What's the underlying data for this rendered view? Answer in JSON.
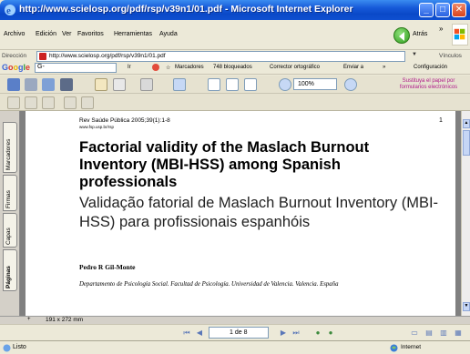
{
  "window": {
    "title": "http://www.scielosp.org/pdf/rsp/v39n1/01.pdf - Microsoft Internet Explorer",
    "min_glyph": "_",
    "max_glyph": "□",
    "close_glyph": "✕"
  },
  "menu": {
    "items": [
      "Archivo",
      "Edición",
      "Ver",
      "Favoritos",
      "Herramientas",
      "Ayuda"
    ],
    "back_label": "Atrás",
    "chevron": "»"
  },
  "address": {
    "label": "Dirección",
    "value": "http://www.scielosp.org/pdf/rsp/v39n1/01.pdf",
    "links_label": "Vínculos"
  },
  "google_bar": {
    "logo": "Google",
    "search_value": "G-",
    "go_label": "Ir",
    "bookmarks_label": "Marcadores",
    "blocked_label": "748 bloqueados",
    "spellcheck_label": "Corrector ortográfico",
    "send_label": "Enviar a",
    "settings_label": "Configuración"
  },
  "acrobat": {
    "zoom_value": "100%",
    "promo_text": "Sustituya el papel por formularios electrónicos",
    "tabs": [
      "Marcadores",
      "Firmas",
      "Capas",
      "Páginas"
    ],
    "page_size": "191 x 272 mm",
    "page_indicator": "1 de 8"
  },
  "document": {
    "journal": "Rev Saúde Pública 2005;39(1):1-8",
    "url": "www.fsp.usp.br/rsp",
    "page_number": "1",
    "title_en": "Factorial validity of the Maslach Burnout Inventory (MBI-HSS) among Spanish professionals",
    "title_pt": "Validação fatorial de Maslach Burnout Inventory (MBI-HSS) para profissionais espanhóis",
    "author": "Pedro R Gil-Monte",
    "affiliation": "Departamento de Psicología Social. Facultad de Psicología. Universidad de Valencia. Valencia. España"
  },
  "status": {
    "text": "Listo",
    "zone": "Internet"
  },
  "colors": {
    "titlebar": "#0a49c8",
    "promo": "#b01a8a"
  }
}
